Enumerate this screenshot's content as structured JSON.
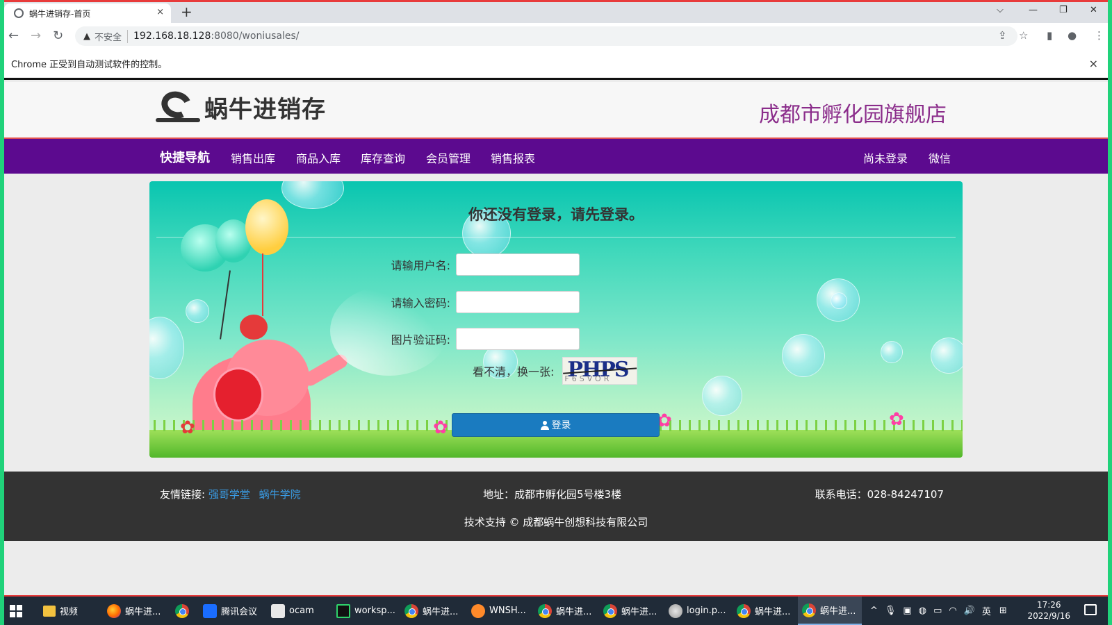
{
  "browser": {
    "tab_title": "蜗牛进销存-首页",
    "tab_close": "×",
    "new_tab": "+",
    "window_controls": {
      "dropdown": "⌵",
      "minimize": "—",
      "restore": "❐",
      "close": "✕"
    },
    "nav": {
      "back": "←",
      "forward": "→",
      "reload": "↻"
    },
    "security_label": "不安全",
    "url_host": "192.168.18.128",
    "url_path": ":8080/woniusales/",
    "automation_notice": "Chrome 正受到自动测试软件的控制。",
    "automation_close": "×"
  },
  "site": {
    "logo_text": "蜗牛进销存",
    "store_name": "成都市孵化园旗舰店",
    "nav": {
      "brand": "快捷导航",
      "items": [
        "销售出库",
        "商品入库",
        "库存查询",
        "会员管理",
        "销售报表"
      ],
      "right_items": [
        "尚未登录",
        "微信"
      ]
    },
    "login": {
      "heading": "你还没有登录，请先登录。",
      "username_label": "请输用户名:",
      "password_label": "请输入密码:",
      "captcha_label": "图片验证码:",
      "refresh_label": "看不清，换一张:",
      "captcha_text": "PHPS",
      "captcha_subtext": "F6SVOR",
      "button_label": "登录"
    },
    "footer": {
      "links_label": "友情链接:",
      "links": [
        "强哥学堂",
        "蜗牛学院"
      ],
      "address": "地址：成都市孵化园5号楼3楼",
      "phone": "联系电话：028-84247107",
      "copyright": "技术支持 © 成都蜗牛创想科技有限公司"
    }
  },
  "taskbar": {
    "items": [
      {
        "label": "视频",
        "icon": "folder-icon"
      },
      {
        "label": "蜗牛进...",
        "icon": "firefox-icon"
      },
      {
        "label": "",
        "icon": "chrome-icon"
      },
      {
        "label": "腾讯会议",
        "icon": "meeting-icon"
      },
      {
        "label": "ocam",
        "icon": "ocam-icon"
      },
      {
        "label": "worksp...",
        "icon": "pycharm-icon"
      },
      {
        "label": "蜗牛进...",
        "icon": "chrome-icon"
      },
      {
        "label": "WNSH...",
        "icon": "app-icon"
      },
      {
        "label": "蜗牛进...",
        "icon": "chrome-icon"
      },
      {
        "label": "蜗牛进...",
        "icon": "chrome-icon"
      },
      {
        "label": "login.p...",
        "icon": "paint-icon"
      },
      {
        "label": "蜗牛进...",
        "icon": "chrome-icon"
      },
      {
        "label": "蜗牛进...",
        "icon": "chrome-icon"
      }
    ],
    "ime": "英",
    "time": "17:26",
    "date": "2022/9/16"
  }
}
